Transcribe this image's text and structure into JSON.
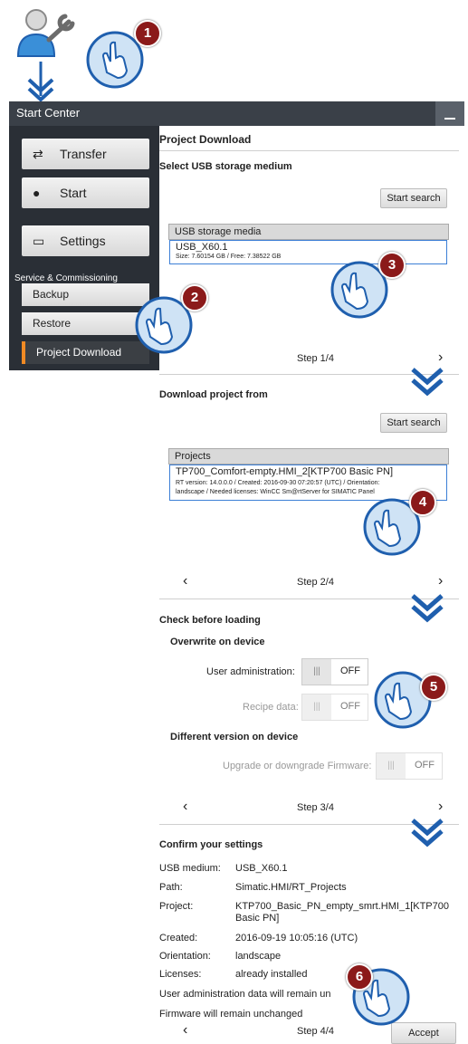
{
  "start_center": {
    "title": "Start Center",
    "nav": [
      {
        "label": "Transfer",
        "icon": "transfer-arrows-icon"
      },
      {
        "label": "Start",
        "icon": "play-icon"
      },
      {
        "label": "Settings",
        "icon": "settings-panel-icon"
      }
    ],
    "service_label": "Service & Commissioning",
    "sub_items": [
      "Backup",
      "Restore",
      "Project Download"
    ]
  },
  "step1": {
    "title": "Project Download",
    "subtitle": "Select USB storage medium",
    "search_button": "Start search",
    "list_header": "USB storage media",
    "item_name": "USB_X60.1",
    "item_detail": "Size: 7.60154 GB / Free: 7.38522 GB",
    "step_label": "Step 1/4"
  },
  "step2": {
    "subtitle": "Download project from",
    "search_button": "Start search",
    "list_header": "Projects",
    "item_name": "TP700_Comfort-empty.HMI_2[KTP700 Basic PN]",
    "item_detail_1": "RT version: 14.0.0.0 / Created: 2016-09-30 07:20:57 (UTC) / Orientation:",
    "item_detail_2": "landscape / Needed licenses: WinCC Sm@rtServer for SIMATIC Panel",
    "step_label": "Step 2/4"
  },
  "step3": {
    "subtitle": "Check before loading",
    "overwrite_heading": "Overwrite on device",
    "user_admin_label": "User administration:",
    "recipe_label": "Recipe data:",
    "different_heading": "Different version on device",
    "firmware_label": "Upgrade or downgrade Firmware:",
    "toggle_knob": "|||",
    "toggle_off": "OFF",
    "step_label": "Step 3/4"
  },
  "step4": {
    "subtitle": "Confirm your settings",
    "rows": [
      {
        "key": "USB medium:",
        "value": "USB_X60.1"
      },
      {
        "key": "Path:",
        "value": "Simatic.HMI/RT_Projects"
      },
      {
        "key": "Project:",
        "value": "KTP700_Basic_PN_empty_smrt.HMI_1[KTP700"
      },
      {
        "key": "",
        "value": "Basic PN]"
      },
      {
        "key": "Created:",
        "value": "2016-09-19 10:05:16 (UTC)"
      },
      {
        "key": "Orientation:",
        "value": "landscape"
      },
      {
        "key": "Licenses:",
        "value": "already installed"
      }
    ],
    "user_admin_note": "User administration data will remain un",
    "firmware_note": "Firmware will remain unchanged",
    "step_label": "Step 4/4",
    "accept_button": "Accept"
  },
  "chevrons": {
    "next": "›",
    "prev": "‹"
  },
  "badges": [
    "1",
    "2",
    "3",
    "4",
    "5",
    "6"
  ],
  "colors": {
    "accent_orange": "#f08a24",
    "badge_red": "#8b1a1a",
    "arrow_blue": "#1f5fae",
    "sidebar": "#2a2f36"
  }
}
